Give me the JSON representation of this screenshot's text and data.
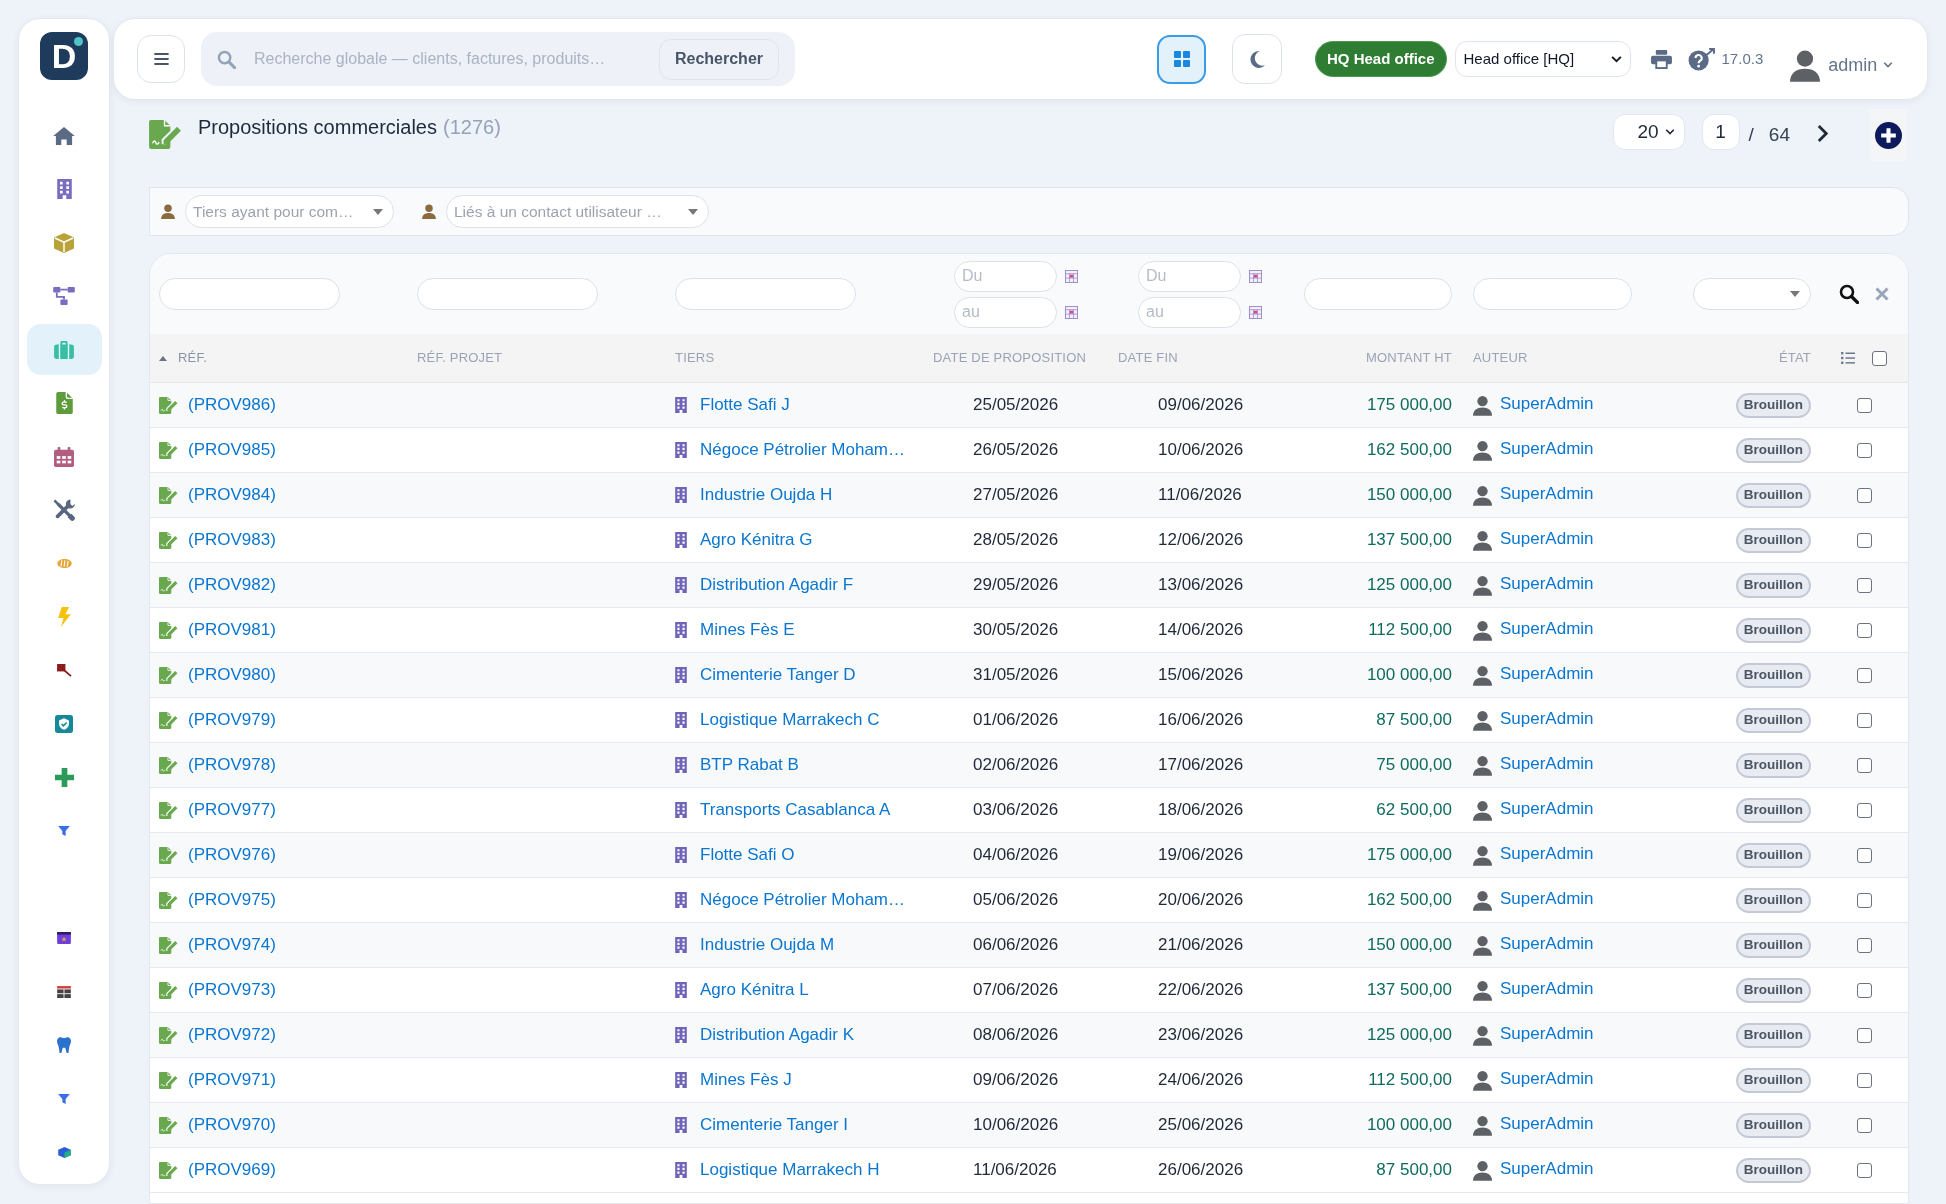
{
  "sidebar": {
    "logo": "D",
    "groups": [
      {
        "items": [
          {
            "selected": false
          },
          {
            "selected": false
          },
          {
            "selected": false
          },
          {
            "selected": false
          },
          {
            "selected": true
          },
          {
            "selected": false
          },
          {
            "selected": false
          },
          {
            "selected": false
          },
          {
            "selected": false
          },
          {
            "selected": false
          },
          {
            "selected": false
          },
          {
            "selected": false
          },
          {
            "selected": false
          },
          {
            "selected": false
          }
        ]
      },
      {
        "items": [
          {
            "selected": false
          },
          {
            "selected": false
          },
          {
            "selected": false
          },
          {
            "selected": false
          },
          {
            "selected": false
          }
        ]
      }
    ]
  },
  "top_bar": {
    "search": {
      "placeholder": "Recherche globale — clients, factures, produits…",
      "button": "Rechercher"
    },
    "layout_toggle": {
      "on": true
    },
    "dark_mode": {
      "on": false
    },
    "entity_badge": "HQ Head office",
    "entity_select": "Head office [HQ]",
    "version": "17.0.3",
    "user": "admin"
  },
  "page": {
    "title": "Propositions commerciales",
    "count": "(1276)",
    "pagination": {
      "page_size": "20",
      "page": "1",
      "separator": "/",
      "total_pages": "64"
    }
  },
  "filter_bar": [
    {
      "placeholder": "Tiers ayant pour com…"
    },
    {
      "placeholder": "Liés à un contact utilisateur …"
    }
  ],
  "table": {
    "date_filters": [
      {
        "placeholder_from": "Du",
        "placeholder_to": "au"
      },
      {
        "placeholder_from": "Du",
        "placeholder_to": "au"
      }
    ],
    "columns": [
      {
        "label": "RÉF.",
        "sorted": true
      },
      {
        "label": "RÉF. PROJET",
        "sorted": false
      },
      {
        "label": "TIERS",
        "sorted": false
      },
      {
        "label": "DATE DE PROPOSITION",
        "sorted": false
      },
      {
        "label": "DATE FIN",
        "sorted": false
      },
      {
        "label": "MONTANT HT",
        "sorted": false
      },
      {
        "label": "AUTEUR",
        "sorted": false
      },
      {
        "label": "ÉTAT",
        "sorted": false
      }
    ],
    "select_all": {
      "checked": false
    },
    "rows": [
      {
        "ref": "(PROV986)",
        "third_party": "Flotte Safi J",
        "date": "25/05/2026",
        "end_date": "09/06/2026",
        "amount": "175 000,00",
        "author": "SuperAdmin",
        "status": "Brouillon",
        "checked": false
      },
      {
        "ref": "(PROV985)",
        "third_party": "Négoce Pétrolier Moham…",
        "date": "26/05/2026",
        "end_date": "10/06/2026",
        "amount": "162 500,00",
        "author": "SuperAdmin",
        "status": "Brouillon",
        "checked": false
      },
      {
        "ref": "(PROV984)",
        "third_party": "Industrie Oujda H",
        "date": "27/05/2026",
        "end_date": "11/06/2026",
        "amount": "150 000,00",
        "author": "SuperAdmin",
        "status": "Brouillon",
        "checked": false
      },
      {
        "ref": "(PROV983)",
        "third_party": "Agro Kénitra G",
        "date": "28/05/2026",
        "end_date": "12/06/2026",
        "amount": "137 500,00",
        "author": "SuperAdmin",
        "status": "Brouillon",
        "checked": false
      },
      {
        "ref": "(PROV982)",
        "third_party": "Distribution Agadir F",
        "date": "29/05/2026",
        "end_date": "13/06/2026",
        "amount": "125 000,00",
        "author": "SuperAdmin",
        "status": "Brouillon",
        "checked": false
      },
      {
        "ref": "(PROV981)",
        "third_party": "Mines Fès E",
        "date": "30/05/2026",
        "end_date": "14/06/2026",
        "amount": "112 500,00",
        "author": "SuperAdmin",
        "status": "Brouillon",
        "checked": false
      },
      {
        "ref": "(PROV980)",
        "third_party": "Cimenterie Tanger D",
        "date": "31/05/2026",
        "end_date": "15/06/2026",
        "amount": "100 000,00",
        "author": "SuperAdmin",
        "status": "Brouillon",
        "checked": false
      },
      {
        "ref": "(PROV979)",
        "third_party": "Logistique Marrakech C",
        "date": "01/06/2026",
        "end_date": "16/06/2026",
        "amount": "87 500,00",
        "author": "SuperAdmin",
        "status": "Brouillon",
        "checked": false
      },
      {
        "ref": "(PROV978)",
        "third_party": "BTP Rabat B",
        "date": "02/06/2026",
        "end_date": "17/06/2026",
        "amount": "75 000,00",
        "author": "SuperAdmin",
        "status": "Brouillon",
        "checked": false
      },
      {
        "ref": "(PROV977)",
        "third_party": "Transports Casablanca A",
        "date": "03/06/2026",
        "end_date": "18/06/2026",
        "amount": "62 500,00",
        "author": "SuperAdmin",
        "status": "Brouillon",
        "checked": false
      },
      {
        "ref": "(PROV976)",
        "third_party": "Flotte Safi O",
        "date": "04/06/2026",
        "end_date": "19/06/2026",
        "amount": "175 000,00",
        "author": "SuperAdmin",
        "status": "Brouillon",
        "checked": false
      },
      {
        "ref": "(PROV975)",
        "third_party": "Négoce Pétrolier Moham…",
        "date": "05/06/2026",
        "end_date": "20/06/2026",
        "amount": "162 500,00",
        "author": "SuperAdmin",
        "status": "Brouillon",
        "checked": false
      },
      {
        "ref": "(PROV974)",
        "third_party": "Industrie Oujda M",
        "date": "06/06/2026",
        "end_date": "21/06/2026",
        "amount": "150 000,00",
        "author": "SuperAdmin",
        "status": "Brouillon",
        "checked": false
      },
      {
        "ref": "(PROV973)",
        "third_party": "Agro Kénitra L",
        "date": "07/06/2026",
        "end_date": "22/06/2026",
        "amount": "137 500,00",
        "author": "SuperAdmin",
        "status": "Brouillon",
        "checked": false
      },
      {
        "ref": "(PROV972)",
        "third_party": "Distribution Agadir K",
        "date": "08/06/2026",
        "end_date": "23/06/2026",
        "amount": "125 000,00",
        "author": "SuperAdmin",
        "status": "Brouillon",
        "checked": false
      },
      {
        "ref": "(PROV971)",
        "third_party": "Mines Fès J",
        "date": "09/06/2026",
        "end_date": "24/06/2026",
        "amount": "112 500,00",
        "author": "SuperAdmin",
        "status": "Brouillon",
        "checked": false
      },
      {
        "ref": "(PROV970)",
        "third_party": "Cimenterie Tanger I",
        "date": "10/06/2026",
        "end_date": "25/06/2026",
        "amount": "100 000,00",
        "author": "SuperAdmin",
        "status": "Brouillon",
        "checked": false
      },
      {
        "ref": "(PROV969)",
        "third_party": "Logistique Marrakech H",
        "date": "11/06/2026",
        "end_date": "26/06/2026",
        "amount": "87 500,00",
        "author": "SuperAdmin",
        "status": "Brouillon",
        "checked": false
      }
    ]
  }
}
